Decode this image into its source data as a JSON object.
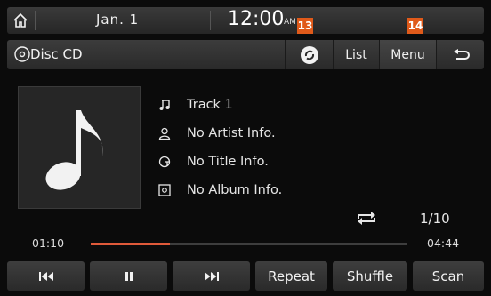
{
  "status": {
    "date": "Jan.  1",
    "time": "12:00",
    "ampm": "AM"
  },
  "callouts": [
    "13",
    "14"
  ],
  "source": {
    "label": "Disc CD"
  },
  "top_buttons": {
    "list": "List",
    "menu": "Menu"
  },
  "track": {
    "title": "Track 1",
    "artist": "No Artist Info.",
    "album_title": "No Title Info.",
    "album": "No Album Info.",
    "count": "1/10",
    "elapsed": "01:10",
    "total": "04:44",
    "progress_fraction": 0.25
  },
  "controls": {
    "repeat": "Repeat",
    "shuffle": "Shuffle",
    "scan": "Scan"
  },
  "colors": {
    "accent": "#e05a1a",
    "progress": "#e05a3a"
  }
}
